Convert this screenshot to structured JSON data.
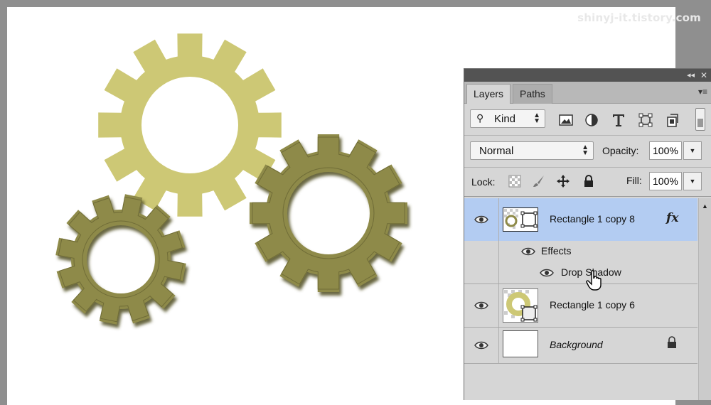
{
  "watermark": "shinyj-it.tistory.com",
  "colors": {
    "gear_light": "#cdc875",
    "gear_dark": "#8e8a48",
    "gear_shadow": "#59562e",
    "panel_bg": "#d6d6d6",
    "selected_layer": "#b3ccf2"
  },
  "panel": {
    "tabs": [
      {
        "label": "Layers",
        "active": true
      },
      {
        "label": "Paths",
        "active": false
      }
    ],
    "filter": {
      "kind_label": "Kind",
      "icons": [
        "image-filter-icon",
        "adjustment-filter-icon",
        "type-filter-icon",
        "shape-filter-icon",
        "smart-object-filter-icon"
      ]
    },
    "blend_mode": "Normal",
    "opacity_label": "Opacity:",
    "opacity_value": "100%",
    "lock_label": "Lock:",
    "fill_label": "Fill:",
    "fill_value": "100%",
    "layers": [
      {
        "name": "Rectangle 1 copy 8",
        "selected": true,
        "has_fx": true,
        "fx_label": "fx"
      },
      {
        "name": "Effects"
      },
      {
        "name": "Drop Shadow"
      },
      {
        "name": "Rectangle 1 copy 6",
        "selected": false
      },
      {
        "name": "Background",
        "locked": true
      }
    ]
  }
}
